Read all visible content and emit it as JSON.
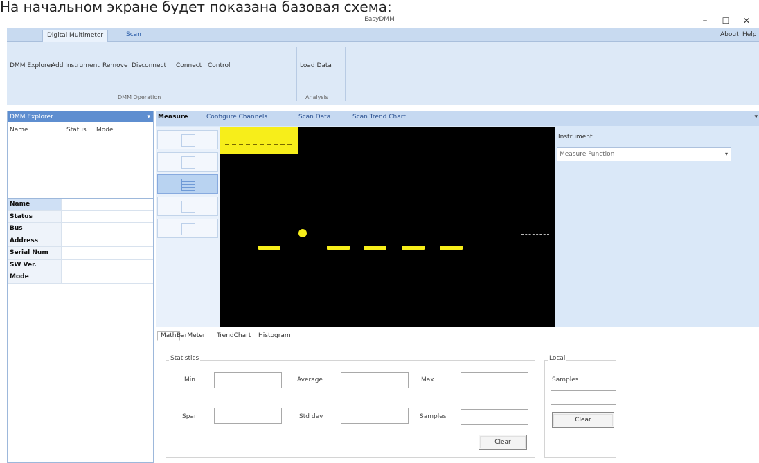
{
  "caption": "На начальном экране будет показана базовая схема:",
  "window": {
    "title": "EasyDMM",
    "minimize": "–",
    "maximize": "☐",
    "close": "✕"
  },
  "ribbon": {
    "tabs": [
      "Digital Multimeter",
      "Scan"
    ],
    "right_items": [
      "About",
      "Help"
    ],
    "dmm_buttons": [
      "DMM Explorer",
      "Add Instrument",
      "Remove",
      "Disconnect",
      "Connect",
      "Control"
    ],
    "analysis_buttons": [
      "Load Data"
    ],
    "group_labels": {
      "dmm": "DMM Operation",
      "analysis": "Analysis"
    }
  },
  "explorer": {
    "title": "DMM Explorer",
    "pin": "▾",
    "columns": [
      "Name",
      "Status",
      "Mode"
    ],
    "properties": [
      "Name",
      "Status",
      "Bus",
      "Address",
      "Serial Num",
      "SW Ver.",
      "Mode"
    ]
  },
  "main_tabs": [
    "Measure",
    "Configure Channels",
    "Scan Data",
    "Scan Trend Chart"
  ],
  "overflow": "▾",
  "instrument": {
    "label": "Instrument",
    "measure_function": "Measure Function",
    "arrow": "▾"
  },
  "bottom": {
    "tabs": [
      "Math",
      "BarMeter",
      "TrendChart",
      "Histogram"
    ],
    "statistics": {
      "title": "Statistics",
      "min": "Min",
      "average": "Average",
      "max": "Max",
      "span": "Span",
      "std_dev": "Std dev",
      "samples": "Samples",
      "clear": "Clear"
    },
    "local": {
      "title": "Local",
      "samples": "Samples",
      "clear": "Clear"
    }
  },
  "colors": {
    "display_bg": "#000000",
    "segment": "#f7ee1a",
    "ribbon": "#dde9f7",
    "explorer_header": "#5e8ed0"
  }
}
